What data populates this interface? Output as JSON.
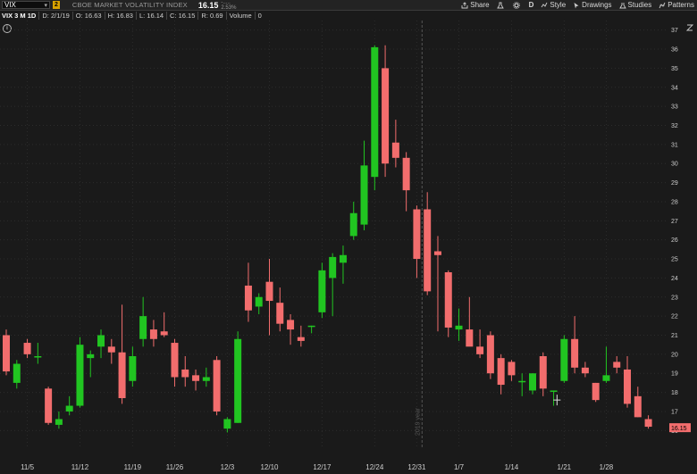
{
  "toolbar": {
    "symbol": "VIX",
    "link_badge": "2",
    "description": "CBOE MARKET VOLATILITY INDEX",
    "last_price": "16.15",
    "change": "-.....",
    "change_pct": "2.53%",
    "share_label": "Share",
    "aggregation_label": "D",
    "style_label": "Style",
    "drawings_label": "Drawings",
    "studies_label": "Studies",
    "patterns_label": "Patterns"
  },
  "infobar": {
    "name": "VIX 3 M 1D",
    "date": "D: 2/1/19",
    "open": "O: 16.63",
    "high": "H: 16.83",
    "low": "L: 16.14",
    "close": "C: 16.15",
    "range": "R: 0.69",
    "volume_label": "Volume",
    "volume_value": "0"
  },
  "colors": {
    "background": "#1a1a1a",
    "up": "#21c521",
    "down": "#f26d6d",
    "grid": "#2c2c2c",
    "axis_text": "#cfcfcf",
    "last_price_tag": "#f26d6d"
  },
  "chart_data": {
    "type": "candlestick",
    "instrument": "VIX",
    "ylim": [
      15.5,
      37.5
    ],
    "y_ticks": [
      16,
      17,
      18,
      19,
      20,
      21,
      22,
      23,
      24,
      25,
      26,
      27,
      28,
      29,
      30,
      31,
      32,
      33,
      34,
      35,
      36,
      37
    ],
    "x_ticks": [
      {
        "label": "11/5",
        "index": 2
      },
      {
        "label": "11/12",
        "index": 7
      },
      {
        "label": "11/19",
        "index": 12
      },
      {
        "label": "11/26",
        "index": 16
      },
      {
        "label": "12/3",
        "index": 21
      },
      {
        "label": "12/10",
        "index": 25
      },
      {
        "label": "12/17",
        "index": 30
      },
      {
        "label": "12/24",
        "index": 35
      },
      {
        "label": "12/31",
        "index": 39
      },
      {
        "label": "1/7",
        "index": 43
      },
      {
        "label": "1/14",
        "index": 48
      },
      {
        "label": "1/21",
        "index": 53
      },
      {
        "label": "1/28",
        "index": 57
      }
    ],
    "year_divider_index": 39.5,
    "year_label": "2019 year",
    "last_price": 16.15,
    "candles": [
      {
        "o": 21.0,
        "h": 21.3,
        "l": 18.9,
        "c": 19.1
      },
      {
        "o": 18.5,
        "h": 19.7,
        "l": 18.2,
        "c": 19.5
      },
      {
        "o": 20.6,
        "h": 20.8,
        "l": 19.8,
        "c": 20.0
      },
      {
        "o": 19.9,
        "h": 20.6,
        "l": 19.5,
        "c": 19.9
      },
      {
        "o": 18.2,
        "h": 18.3,
        "l": 16.3,
        "c": 16.4
      },
      {
        "o": 16.3,
        "h": 17.0,
        "l": 16.1,
        "c": 16.6
      },
      {
        "o": 17.0,
        "h": 17.8,
        "l": 16.8,
        "c": 17.3
      },
      {
        "o": 17.3,
        "h": 20.9,
        "l": 17.2,
        "c": 20.5
      },
      {
        "o": 19.8,
        "h": 20.2,
        "l": 18.8,
        "c": 20.0
      },
      {
        "o": 20.4,
        "h": 21.3,
        "l": 19.8,
        "c": 21.0
      },
      {
        "o": 20.4,
        "h": 20.8,
        "l": 19.5,
        "c": 20.1
      },
      {
        "o": 20.1,
        "h": 22.6,
        "l": 17.4,
        "c": 17.7
      },
      {
        "o": 18.6,
        "h": 20.4,
        "l": 18.3,
        "c": 19.9
      },
      {
        "o": 20.8,
        "h": 23.0,
        "l": 20.4,
        "c": 22.0
      },
      {
        "o": 21.3,
        "h": 21.8,
        "l": 20.4,
        "c": 20.8
      },
      {
        "o": 21.2,
        "h": 22.2,
        "l": 20.9,
        "c": 21.0
      },
      {
        "o": 20.6,
        "h": 20.8,
        "l": 18.3,
        "c": 18.8
      },
      {
        "o": 19.2,
        "h": 19.9,
        "l": 18.3,
        "c": 18.8
      },
      {
        "o": 18.9,
        "h": 19.2,
        "l": 18.1,
        "c": 18.6
      },
      {
        "o": 18.6,
        "h": 19.3,
        "l": 18.3,
        "c": 18.8
      },
      {
        "o": 19.7,
        "h": 19.9,
        "l": 16.8,
        "c": 17.0
      },
      {
        "o": 16.1,
        "h": 16.7,
        "l": 15.9,
        "c": 16.6
      },
      {
        "o": 16.4,
        "h": 21.2,
        "l": 16.4,
        "c": 20.8
      },
      {
        "o": 23.6,
        "h": 24.8,
        "l": 21.7,
        "c": 22.3
      },
      {
        "o": 22.5,
        "h": 23.2,
        "l": 22.1,
        "c": 23.0
      },
      {
        "o": 23.8,
        "h": 25.0,
        "l": 21.0,
        "c": 22.8
      },
      {
        "o": 22.7,
        "h": 23.5,
        "l": 21.2,
        "c": 21.6
      },
      {
        "o": 21.8,
        "h": 22.1,
        "l": 20.5,
        "c": 21.3
      },
      {
        "o": 20.9,
        "h": 21.5,
        "l": 20.4,
        "c": 20.7
      },
      {
        "o": 21.5,
        "h": 21.5,
        "l": 21.1,
        "c": 21.5
      },
      {
        "o": 22.2,
        "h": 24.8,
        "l": 21.9,
        "c": 24.4
      },
      {
        "o": 24.0,
        "h": 25.3,
        "l": 22.0,
        "c": 25.1
      },
      {
        "o": 24.8,
        "h": 25.7,
        "l": 23.7,
        "c": 25.2
      },
      {
        "o": 26.2,
        "h": 28.0,
        "l": 26.0,
        "c": 27.4
      },
      {
        "o": 26.8,
        "h": 31.2,
        "l": 26.5,
        "c": 29.9
      },
      {
        "o": 29.3,
        "h": 36.2,
        "l": 28.6,
        "c": 36.1
      },
      {
        "o": 35.0,
        "h": 36.2,
        "l": 29.3,
        "c": 30.0
      },
      {
        "o": 31.1,
        "h": 32.3,
        "l": 29.8,
        "c": 30.3
      },
      {
        "o": 30.3,
        "h": 30.6,
        "l": 27.5,
        "c": 28.6
      },
      {
        "o": 27.6,
        "h": 27.8,
        "l": 24.0,
        "c": 25.0
      },
      {
        "o": 27.6,
        "h": 28.5,
        "l": 23.1,
        "c": 23.3
      },
      {
        "o": 25.4,
        "h": 26.2,
        "l": 21.2,
        "c": 25.2
      },
      {
        "o": 24.3,
        "h": 24.4,
        "l": 20.9,
        "c": 21.4
      },
      {
        "o": 21.3,
        "h": 22.4,
        "l": 20.7,
        "c": 21.5
      },
      {
        "o": 21.3,
        "h": 23.0,
        "l": 20.5,
        "c": 20.4
      },
      {
        "o": 20.4,
        "h": 21.3,
        "l": 19.8,
        "c": 20.0
      },
      {
        "o": 21.0,
        "h": 21.2,
        "l": 18.7,
        "c": 19.0
      },
      {
        "o": 19.8,
        "h": 20.0,
        "l": 17.9,
        "c": 18.4
      },
      {
        "o": 19.6,
        "h": 19.7,
        "l": 18.6,
        "c": 18.9
      },
      {
        "o": 18.6,
        "h": 19.0,
        "l": 17.8,
        "c": 18.6
      },
      {
        "o": 18.1,
        "h": 19.0,
        "l": 17.9,
        "c": 19.0
      },
      {
        "o": 19.9,
        "h": 20.1,
        "l": 17.8,
        "c": 18.2
      },
      {
        "o": 18.1,
        "h": 18.1,
        "l": 17.3,
        "c": 18.1
      },
      {
        "o": 18.6,
        "h": 21.0,
        "l": 18.5,
        "c": 20.8
      },
      {
        "o": 20.8,
        "h": 22.0,
        "l": 19.0,
        "c": 19.3
      },
      {
        "o": 19.3,
        "h": 19.6,
        "l": 18.8,
        "c": 19.0
      },
      {
        "o": 18.5,
        "h": 18.5,
        "l": 17.5,
        "c": 17.6
      },
      {
        "o": 18.6,
        "h": 20.4,
        "l": 18.5,
        "c": 18.9
      },
      {
        "o": 19.6,
        "h": 19.9,
        "l": 19.0,
        "c": 19.3
      },
      {
        "o": 19.2,
        "h": 19.9,
        "l": 17.2,
        "c": 17.4
      },
      {
        "o": 17.8,
        "h": 18.3,
        "l": 16.7,
        "c": 16.7
      },
      {
        "o": 16.6,
        "h": 16.8,
        "l": 16.1,
        "c": 16.2
      }
    ]
  }
}
